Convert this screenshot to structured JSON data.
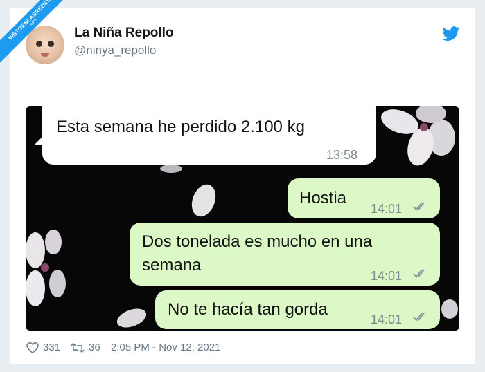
{
  "watermark": {
    "line1": "VISTOENLASREDES",
    "line2": ".com"
  },
  "tweet": {
    "author_name": "La Niña Repollo",
    "author_handle": "@ninya_repollo",
    "likes": "331",
    "retweets": "36",
    "timestamp": "2:05 PM - Nov 12, 2021"
  },
  "chat": {
    "messages": [
      {
        "direction": "incoming",
        "text": "Esta semana he perdido 2.100 kg",
        "time": "13:58"
      },
      {
        "direction": "outgoing",
        "text": "Hostia",
        "time": "14:01"
      },
      {
        "direction": "outgoing",
        "text_line1": "Dos tonelada es mucho en una",
        "text_line2": "semana",
        "time": "14:01"
      },
      {
        "direction": "outgoing",
        "text": "No te hacía tan gorda",
        "time": "14:01"
      }
    ]
  },
  "colors": {
    "twitter_blue": "#1d9bf0",
    "outgoing_bubble": "#dcf8c6",
    "incoming_bubble": "#ffffff",
    "chat_background": "#070707"
  },
  "icons": [
    "twitter-bird-icon",
    "heart-icon",
    "retweet-icon",
    "double-check-icon"
  ]
}
